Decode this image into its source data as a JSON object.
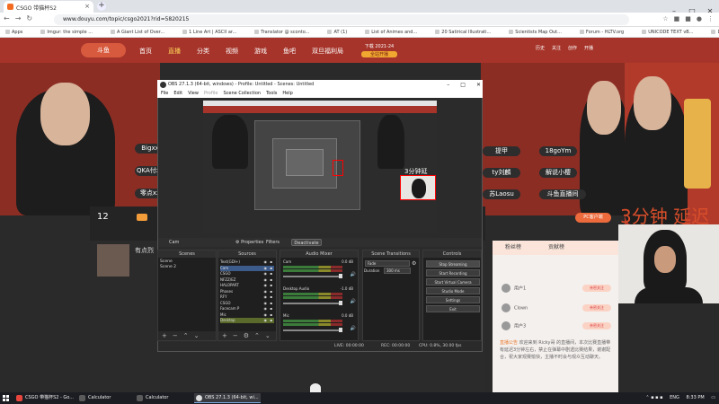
{
  "browser": {
    "tab_title": "CSGO 带猫杯S2",
    "url": "www.douyu.com/topic/csgo2021?rid=5820215",
    "bookmarks": [
      "Apps",
      "Imgur: the simple ...",
      "A Giant List of Over...",
      "1 Line Art | ASCII ar...",
      "Translator @ sconto...",
      "AT (1)",
      "List of Animes and...",
      "20 Satirical Illustrati...",
      "Scientists Map Out...",
      "Forum - HLTV.org",
      "UNICODE TEXT vB...",
      "Dave2k / cheaters...",
      "Steamflex ~ Lol, Bo..."
    ]
  },
  "site": {
    "nav": [
      "首页",
      "直播",
      "分类",
      "视频",
      "游戏",
      "鱼吧",
      "双旦福利局"
    ],
    "active_nav": "直播",
    "promo_line1": "下载 2021-24",
    "promo_badge": "全站开播",
    "header_right": [
      "历史",
      "关注",
      "创作",
      "开播"
    ],
    "names": [
      "Bigxx",
      "QKA付xx",
      "零点xx",
      "提甲",
      "18goYm",
      "ty刘麟",
      "解说小樱",
      "苏Laosu",
      "斗鱼直播间"
    ],
    "overlay_text": "3分钟 延迟",
    "live_count": "12",
    "pc_button": "PC客户端",
    "room_title": "有点烈",
    "chat_tabs": [
      "粉丝榜",
      "贡献榜"
    ],
    "chat_users": [
      "用户1",
      "Clown",
      "用户3"
    ],
    "chat_button": "亲密关注",
    "chat_message_name": "直播公告",
    "chat_message": "欢迎来到 Ricky哥 的直播间，本次比赛直播带有延迟3分钟左右，禁止在弹幕中剧透比赛结果，谢谢配合，祝大家观赛愉快，主播不时会与观众互动聊天。"
  },
  "obs": {
    "title": "OBS 27.1.3 (64-bit, windows) - Profile: Untitled - Scenes: Untitled",
    "menu": [
      "File",
      "Edit",
      "View",
      "Profile",
      "Scene Collection",
      "Tools",
      "Help"
    ],
    "context_source": "Cam",
    "properties_label": "Properties",
    "filters_label": "Filters",
    "deactivate_label": "Deactivate",
    "docks": {
      "scenes": "Scenes",
      "sources": "Sources",
      "mixer": "Audio Mixer",
      "transitions": "Scene Transitions",
      "controls": "Controls"
    },
    "scenes": [
      "Scene",
      "Scene 2"
    ],
    "sources": [
      "Text(GDI+)",
      "Cam",
      "CSGO",
      "NFZZ/EZ",
      "HALOPART",
      "Phases",
      "RFY",
      "CSGO",
      "Facecam P",
      "Mic",
      "Desktop"
    ],
    "mixer": [
      {
        "name": "Cam",
        "db": "0.0 dB"
      },
      {
        "name": "Desktop Audio",
        "db": "-1.0 dB"
      },
      {
        "name": "Mic",
        "db": "0.0 dB"
      }
    ],
    "transition": "Fade",
    "duration_label": "Duration",
    "duration_value": "300 ms",
    "controls": [
      "Stop Streaming",
      "Start Recording",
      "Start Virtual Camera",
      "Studio Mode",
      "Settings",
      "Exit"
    ],
    "status": {
      "live": "LIVE: 00:00:00",
      "rec": "REC: 00:00:00",
      "cpu": "CPU: 0.8%, 30.00 fps"
    },
    "preview_overlay": "3分钟延"
  },
  "taskbar": {
    "items": [
      "CSGO 带猫杯S2 - Go...",
      "Calculator",
      "Calculator",
      "OBS 27.1.3 (64-bit, wi..."
    ],
    "active_index": 3,
    "lang": "ENG",
    "time": "8:33 PM"
  }
}
